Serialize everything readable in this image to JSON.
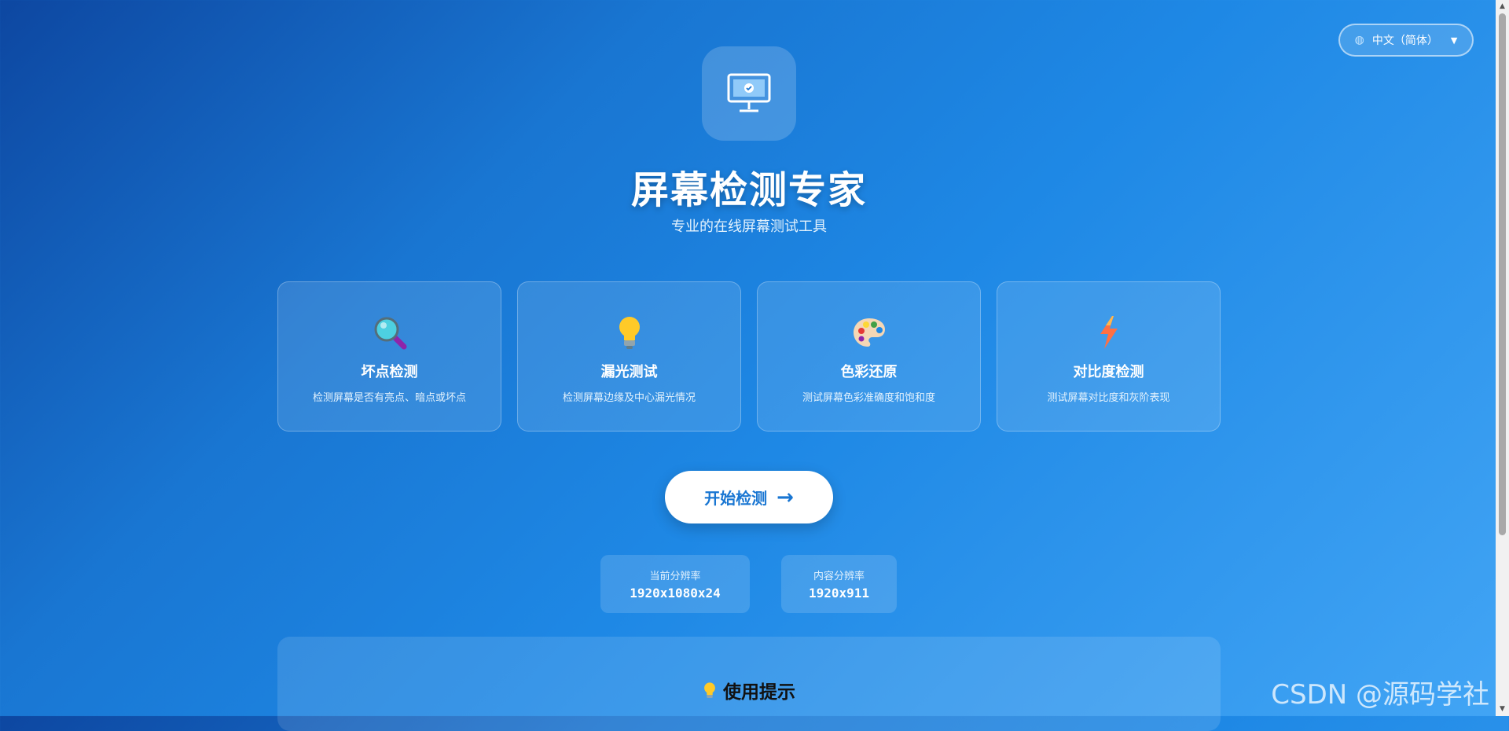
{
  "language": {
    "label": "中文（简体）",
    "globe_icon": "globe-icon",
    "caret_icon": "chevron-down-icon"
  },
  "header": {
    "logo_icon": "monitor-check-icon",
    "title": "屏幕检测专家",
    "subtitle": "专业的在线屏幕测试工具"
  },
  "features": [
    {
      "icon": "magnifier-icon",
      "title": "坏点检测",
      "desc": "检测屏幕是否有亮点、暗点或坏点"
    },
    {
      "icon": "lightbulb-icon",
      "title": "漏光测试",
      "desc": "检测屏幕边缘及中心漏光情况"
    },
    {
      "icon": "palette-icon",
      "title": "色彩还原",
      "desc": "测试屏幕色彩准确度和饱和度"
    },
    {
      "icon": "lightning-icon",
      "title": "对比度检测",
      "desc": "测试屏幕对比度和灰阶表现"
    }
  ],
  "start_button": {
    "label": "开始检测",
    "arrow": "→"
  },
  "resolution": {
    "current_label": "当前分辨率",
    "current_value": "1920x1080x24",
    "content_label": "内容分辨率",
    "content_value": "1920x911"
  },
  "tips": {
    "icon": "lightbulb-icon",
    "title": "使用提示"
  },
  "watermark": "CSDN @源码学社",
  "colors": {
    "accent": "#1976d2",
    "background_start": "#0d47a1",
    "background_end": "#42a5f5"
  }
}
